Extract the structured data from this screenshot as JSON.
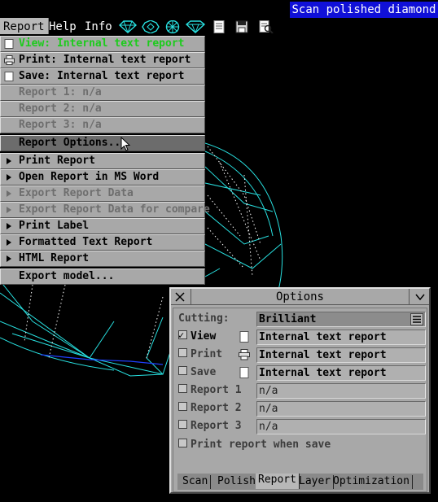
{
  "window": {
    "title": "Scan polished diamond"
  },
  "menubar": {
    "items": [
      "Report",
      "Help",
      "Info"
    ]
  },
  "toolbar": {
    "icons": [
      "diamond-side-icon",
      "diamond-top-icon",
      "diamond-facet-icon",
      "gem-icon",
      "document-icon",
      "save-icon",
      "print-preview-icon"
    ]
  },
  "report_menu": {
    "view": "View: Internal text report",
    "print": "Print: Internal text report",
    "save": "Save: Internal text report",
    "report1": "Report 1: n/a",
    "report2": "Report 2: n/a",
    "report3": "Report 3: n/a",
    "options": "Report Options...",
    "print_report": "Print Report",
    "open_word": "Open Report in MS Word",
    "export_data": "Export Report Data",
    "export_compare": "Export Report Data for compare",
    "print_label": "Print Label",
    "formatted": "Formatted Text Report",
    "html": "HTML Report",
    "export_model": "Export model..."
  },
  "options": {
    "title": "Options",
    "cutting_label": "Cutting:",
    "cutting_value": "Brilliant",
    "view_label": "View",
    "view_value": "Internal text report",
    "view_checked": true,
    "print_label": "Print",
    "print_value": "Internal text report",
    "print_checked": false,
    "save_label": "Save",
    "save_value": "Internal text report",
    "save_checked": false,
    "report1_label": "Report 1",
    "report1_value": "n/a",
    "report2_label": "Report 2",
    "report2_value": "n/a",
    "report3_label": "Report 3",
    "report3_value": "n/a",
    "print_when_save_label": "Print report when save",
    "tabs": [
      "Scan",
      "Polish",
      "Report",
      "Layer",
      "Optimization"
    ],
    "active_tab": "Report"
  },
  "colors": {
    "title_bg": "#1010d8",
    "wire": "#28e0e0",
    "wire_blue": "#2040ff",
    "checked_text": "#1ccc1c"
  }
}
